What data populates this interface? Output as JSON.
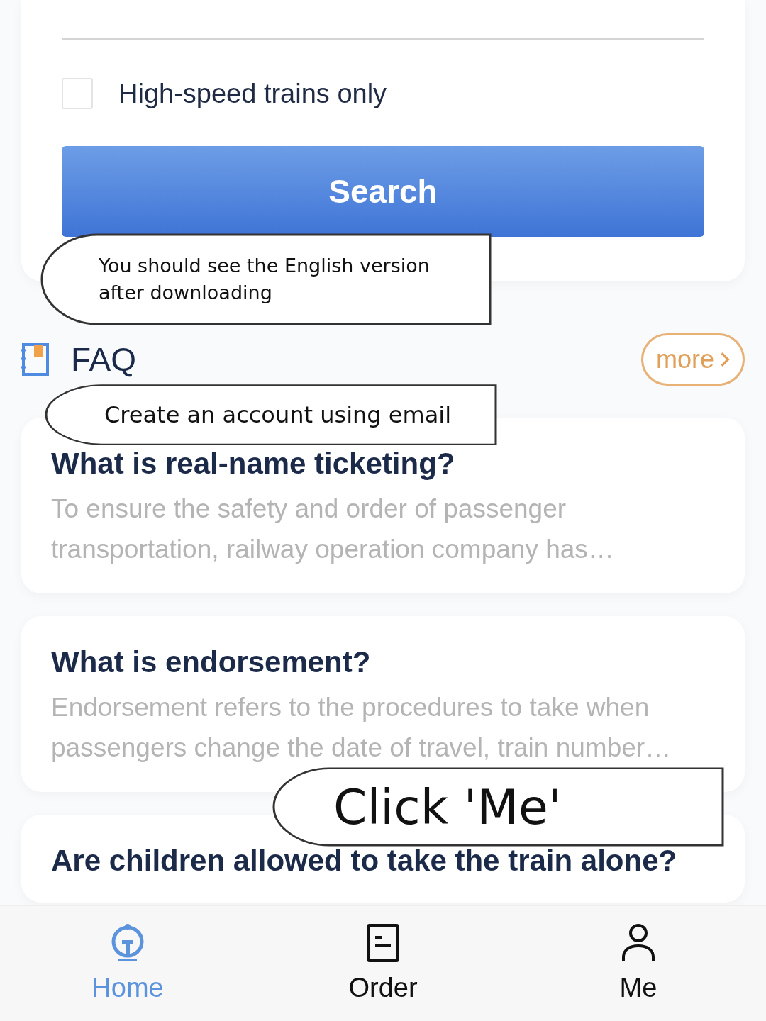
{
  "form": {
    "checkbox": {
      "label": "High-speed trains only",
      "checked": false
    },
    "search_button": "Search"
  },
  "faq": {
    "title": "FAQ",
    "more": "more",
    "items": [
      {
        "question": "What is real-name ticketing?",
        "answer": "To ensure the safety and order of passenger transportation, railway operation company has…"
      },
      {
        "question": "What is endorsement?",
        "answer": "Endorsement refers to the procedures to take when passengers change the date of travel, train number…"
      },
      {
        "question": "Are children allowed to take the train alone?"
      }
    ]
  },
  "callouts": [
    {
      "text": "You should see the English version after downloading"
    },
    {
      "text": "Create an account using email"
    },
    {
      "text": "Click 'Me'"
    }
  ],
  "tab_bar": [
    {
      "label": "Home",
      "selected": true
    },
    {
      "label": "Order",
      "selected": false
    },
    {
      "label": "Me",
      "selected": false
    }
  ]
}
